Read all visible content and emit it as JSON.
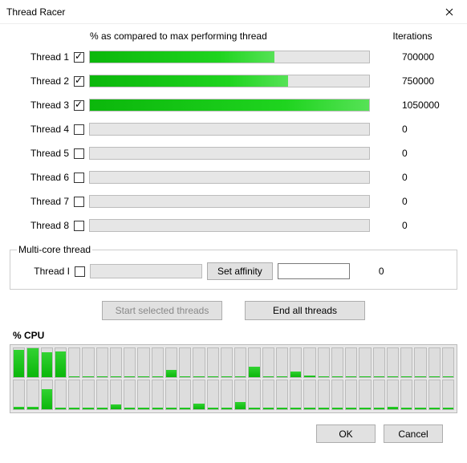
{
  "window": {
    "title": "Thread Racer"
  },
  "headers": {
    "percent": "% as compared to max performing thread",
    "iter": "Iterations"
  },
  "threads": [
    {
      "label": "Thread 1",
      "checked": true,
      "percent": 66,
      "iterations": "700000"
    },
    {
      "label": "Thread 2",
      "checked": true,
      "percent": 71,
      "iterations": "750000"
    },
    {
      "label": "Thread 3",
      "checked": true,
      "percent": 100,
      "iterations": "1050000"
    },
    {
      "label": "Thread 4",
      "checked": false,
      "percent": 0,
      "iterations": "0"
    },
    {
      "label": "Thread 5",
      "checked": false,
      "percent": 0,
      "iterations": "0"
    },
    {
      "label": "Thread 6",
      "checked": false,
      "percent": 0,
      "iterations": "0"
    },
    {
      "label": "Thread 7",
      "checked": false,
      "percent": 0,
      "iterations": "0"
    },
    {
      "label": "Thread 8",
      "checked": false,
      "percent": 0,
      "iterations": "0"
    }
  ],
  "multicore": {
    "legend": "Multi-core thread",
    "label": "Thread I",
    "checked": false,
    "set_affinity": "Set affinity",
    "iterations": "0"
  },
  "actions": {
    "start": "Start selected threads",
    "end": "End all threads"
  },
  "cpu": {
    "title": "% CPU",
    "row1": [
      95,
      100,
      85,
      90,
      2,
      2,
      2,
      2,
      2,
      2,
      2,
      25,
      2,
      2,
      2,
      2,
      2,
      35,
      2,
      2,
      20,
      5,
      2,
      2,
      2,
      2,
      2,
      2,
      2,
      2,
      2,
      2
    ],
    "row2": [
      8,
      8,
      70,
      6,
      6,
      6,
      6,
      18,
      6,
      6,
      6,
      6,
      6,
      20,
      6,
      6,
      25,
      6,
      6,
      6,
      6,
      6,
      6,
      6,
      6,
      6,
      6,
      8,
      6,
      6,
      6,
      6
    ]
  },
  "footer": {
    "ok": "OK",
    "cancel": "Cancel"
  },
  "chart_data": {
    "type": "bar",
    "title": "% as compared to max performing thread",
    "categories": [
      "Thread 1",
      "Thread 2",
      "Thread 3",
      "Thread 4",
      "Thread 5",
      "Thread 6",
      "Thread 7",
      "Thread 8"
    ],
    "values": [
      66,
      71,
      100,
      0,
      0,
      0,
      0,
      0
    ],
    "ylim": [
      0,
      100
    ],
    "xlabel": "",
    "ylabel": "%"
  }
}
